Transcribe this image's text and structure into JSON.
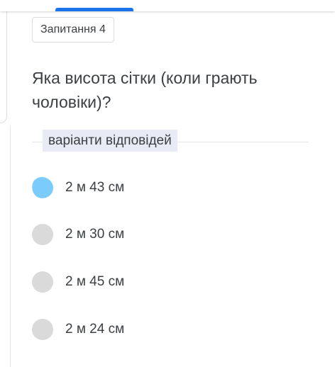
{
  "question": {
    "number_label": "Запитання 4",
    "text": "Яка висота сітки (коли грають чоловіки)?"
  },
  "answers": {
    "section_label": "варіанти відповідей",
    "options": [
      {
        "label": "2 м 43 см",
        "selected": true
      },
      {
        "label": "2 м 30 см",
        "selected": false
      },
      {
        "label": "2 м 45 см",
        "selected": false
      },
      {
        "label": "2 м 24 см",
        "selected": false
      }
    ]
  },
  "colors": {
    "accent": "#1a73e8",
    "selected_radio": "#7cccfb",
    "unselected_radio": "#dadada",
    "section_label_bg": "#e8eaf6",
    "text": "#3c4043"
  }
}
